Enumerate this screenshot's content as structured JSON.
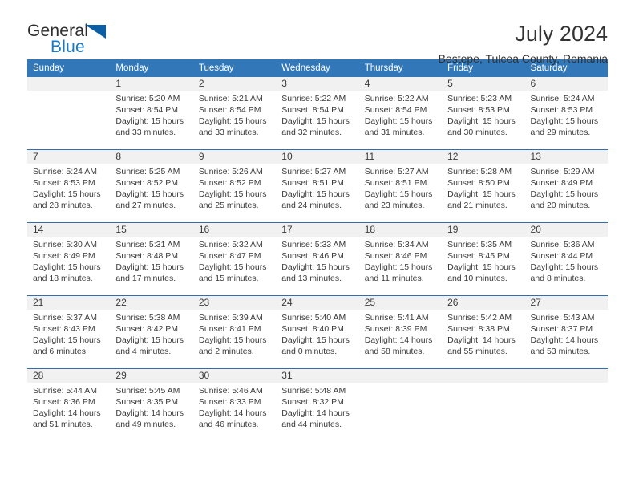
{
  "brand": {
    "word_one": "General",
    "word_two": "Blue",
    "triangle_icon": "triangle-icon",
    "color_dark": "#2f2f2f",
    "color_blue": "#1a7ac4",
    "color_triangle": "#0c5fa5"
  },
  "header": {
    "title": "July 2024",
    "subtitle": "Bestepe, Tulcea County, Romania",
    "accent_color": "#3277b8",
    "band_color": "#f1f1f1",
    "separator_color": "#2f6fb0"
  },
  "weekday_headers": [
    "Sunday",
    "Monday",
    "Tuesday",
    "Wednesday",
    "Thursday",
    "Friday",
    "Saturday"
  ],
  "labels": {
    "sunrise": "Sunrise:",
    "sunset": "Sunset:",
    "daylight": "Daylight:"
  },
  "weeks": [
    [
      {
        "day": "",
        "empty": true
      },
      {
        "day": "1",
        "sunrise": "Sunrise: 5:20 AM",
        "sunset": "Sunset: 8:54 PM",
        "daylight_line1": "Daylight: 15 hours",
        "daylight_line2": "and 33 minutes."
      },
      {
        "day": "2",
        "sunrise": "Sunrise: 5:21 AM",
        "sunset": "Sunset: 8:54 PM",
        "daylight_line1": "Daylight: 15 hours",
        "daylight_line2": "and 33 minutes."
      },
      {
        "day": "3",
        "sunrise": "Sunrise: 5:22 AM",
        "sunset": "Sunset: 8:54 PM",
        "daylight_line1": "Daylight: 15 hours",
        "daylight_line2": "and 32 minutes."
      },
      {
        "day": "4",
        "sunrise": "Sunrise: 5:22 AM",
        "sunset": "Sunset: 8:54 PM",
        "daylight_line1": "Daylight: 15 hours",
        "daylight_line2": "and 31 minutes."
      },
      {
        "day": "5",
        "sunrise": "Sunrise: 5:23 AM",
        "sunset": "Sunset: 8:53 PM",
        "daylight_line1": "Daylight: 15 hours",
        "daylight_line2": "and 30 minutes."
      },
      {
        "day": "6",
        "sunrise": "Sunrise: 5:24 AM",
        "sunset": "Sunset: 8:53 PM",
        "daylight_line1": "Daylight: 15 hours",
        "daylight_line2": "and 29 minutes."
      }
    ],
    [
      {
        "day": "7",
        "sunrise": "Sunrise: 5:24 AM",
        "sunset": "Sunset: 8:53 PM",
        "daylight_line1": "Daylight: 15 hours",
        "daylight_line2": "and 28 minutes."
      },
      {
        "day": "8",
        "sunrise": "Sunrise: 5:25 AM",
        "sunset": "Sunset: 8:52 PM",
        "daylight_line1": "Daylight: 15 hours",
        "daylight_line2": "and 27 minutes."
      },
      {
        "day": "9",
        "sunrise": "Sunrise: 5:26 AM",
        "sunset": "Sunset: 8:52 PM",
        "daylight_line1": "Daylight: 15 hours",
        "daylight_line2": "and 25 minutes."
      },
      {
        "day": "10",
        "sunrise": "Sunrise: 5:27 AM",
        "sunset": "Sunset: 8:51 PM",
        "daylight_line1": "Daylight: 15 hours",
        "daylight_line2": "and 24 minutes."
      },
      {
        "day": "11",
        "sunrise": "Sunrise: 5:27 AM",
        "sunset": "Sunset: 8:51 PM",
        "daylight_line1": "Daylight: 15 hours",
        "daylight_line2": "and 23 minutes."
      },
      {
        "day": "12",
        "sunrise": "Sunrise: 5:28 AM",
        "sunset": "Sunset: 8:50 PM",
        "daylight_line1": "Daylight: 15 hours",
        "daylight_line2": "and 21 minutes."
      },
      {
        "day": "13",
        "sunrise": "Sunrise: 5:29 AM",
        "sunset": "Sunset: 8:49 PM",
        "daylight_line1": "Daylight: 15 hours",
        "daylight_line2": "and 20 minutes."
      }
    ],
    [
      {
        "day": "14",
        "sunrise": "Sunrise: 5:30 AM",
        "sunset": "Sunset: 8:49 PM",
        "daylight_line1": "Daylight: 15 hours",
        "daylight_line2": "and 18 minutes."
      },
      {
        "day": "15",
        "sunrise": "Sunrise: 5:31 AM",
        "sunset": "Sunset: 8:48 PM",
        "daylight_line1": "Daylight: 15 hours",
        "daylight_line2": "and 17 minutes."
      },
      {
        "day": "16",
        "sunrise": "Sunrise: 5:32 AM",
        "sunset": "Sunset: 8:47 PM",
        "daylight_line1": "Daylight: 15 hours",
        "daylight_line2": "and 15 minutes."
      },
      {
        "day": "17",
        "sunrise": "Sunrise: 5:33 AM",
        "sunset": "Sunset: 8:46 PM",
        "daylight_line1": "Daylight: 15 hours",
        "daylight_line2": "and 13 minutes."
      },
      {
        "day": "18",
        "sunrise": "Sunrise: 5:34 AM",
        "sunset": "Sunset: 8:46 PM",
        "daylight_line1": "Daylight: 15 hours",
        "daylight_line2": "and 11 minutes."
      },
      {
        "day": "19",
        "sunrise": "Sunrise: 5:35 AM",
        "sunset": "Sunset: 8:45 PM",
        "daylight_line1": "Daylight: 15 hours",
        "daylight_line2": "and 10 minutes."
      },
      {
        "day": "20",
        "sunrise": "Sunrise: 5:36 AM",
        "sunset": "Sunset: 8:44 PM",
        "daylight_line1": "Daylight: 15 hours",
        "daylight_line2": "and 8 minutes."
      }
    ],
    [
      {
        "day": "21",
        "sunrise": "Sunrise: 5:37 AM",
        "sunset": "Sunset: 8:43 PM",
        "daylight_line1": "Daylight: 15 hours",
        "daylight_line2": "and 6 minutes."
      },
      {
        "day": "22",
        "sunrise": "Sunrise: 5:38 AM",
        "sunset": "Sunset: 8:42 PM",
        "daylight_line1": "Daylight: 15 hours",
        "daylight_line2": "and 4 minutes."
      },
      {
        "day": "23",
        "sunrise": "Sunrise: 5:39 AM",
        "sunset": "Sunset: 8:41 PM",
        "daylight_line1": "Daylight: 15 hours",
        "daylight_line2": "and 2 minutes."
      },
      {
        "day": "24",
        "sunrise": "Sunrise: 5:40 AM",
        "sunset": "Sunset: 8:40 PM",
        "daylight_line1": "Daylight: 15 hours",
        "daylight_line2": "and 0 minutes."
      },
      {
        "day": "25",
        "sunrise": "Sunrise: 5:41 AM",
        "sunset": "Sunset: 8:39 PM",
        "daylight_line1": "Daylight: 14 hours",
        "daylight_line2": "and 58 minutes."
      },
      {
        "day": "26",
        "sunrise": "Sunrise: 5:42 AM",
        "sunset": "Sunset: 8:38 PM",
        "daylight_line1": "Daylight: 14 hours",
        "daylight_line2": "and 55 minutes."
      },
      {
        "day": "27",
        "sunrise": "Sunrise: 5:43 AM",
        "sunset": "Sunset: 8:37 PM",
        "daylight_line1": "Daylight: 14 hours",
        "daylight_line2": "and 53 minutes."
      }
    ],
    [
      {
        "day": "28",
        "sunrise": "Sunrise: 5:44 AM",
        "sunset": "Sunset: 8:36 PM",
        "daylight_line1": "Daylight: 14 hours",
        "daylight_line2": "and 51 minutes."
      },
      {
        "day": "29",
        "sunrise": "Sunrise: 5:45 AM",
        "sunset": "Sunset: 8:35 PM",
        "daylight_line1": "Daylight: 14 hours",
        "daylight_line2": "and 49 minutes."
      },
      {
        "day": "30",
        "sunrise": "Sunrise: 5:46 AM",
        "sunset": "Sunset: 8:33 PM",
        "daylight_line1": "Daylight: 14 hours",
        "daylight_line2": "and 46 minutes."
      },
      {
        "day": "31",
        "sunrise": "Sunrise: 5:48 AM",
        "sunset": "Sunset: 8:32 PM",
        "daylight_line1": "Daylight: 14 hours",
        "daylight_line2": "and 44 minutes."
      },
      {
        "day": "",
        "empty": true
      },
      {
        "day": "",
        "empty": true
      },
      {
        "day": "",
        "empty": true
      }
    ]
  ]
}
